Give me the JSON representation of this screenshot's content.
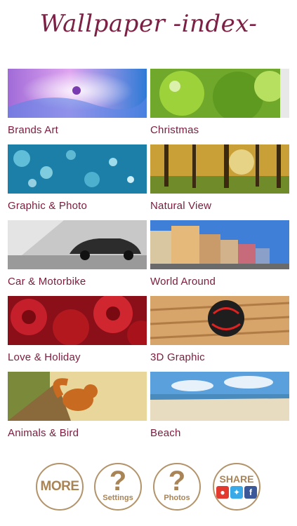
{
  "app": {
    "title": "Wallpaper -index-"
  },
  "categories": [
    {
      "label": "Brands Art"
    },
    {
      "label": "Christmas"
    },
    {
      "label": "Graphic & Photo"
    },
    {
      "label": "Natural View"
    },
    {
      "label": "Car & Motorbike"
    },
    {
      "label": "World Around"
    },
    {
      "label": "Love & Holiday"
    },
    {
      "label": "3D Graphic"
    },
    {
      "label": "Animals & Bird"
    },
    {
      "label": "Beach"
    }
  ],
  "buttons": {
    "more": "MORE",
    "settings_q": "?",
    "settings": "Settings",
    "photos_q": "?",
    "photos": "Photos",
    "share": "SHARE"
  },
  "colors": {
    "title": "#7d2045",
    "label": "#7a1c3e",
    "button": "#a98456"
  }
}
